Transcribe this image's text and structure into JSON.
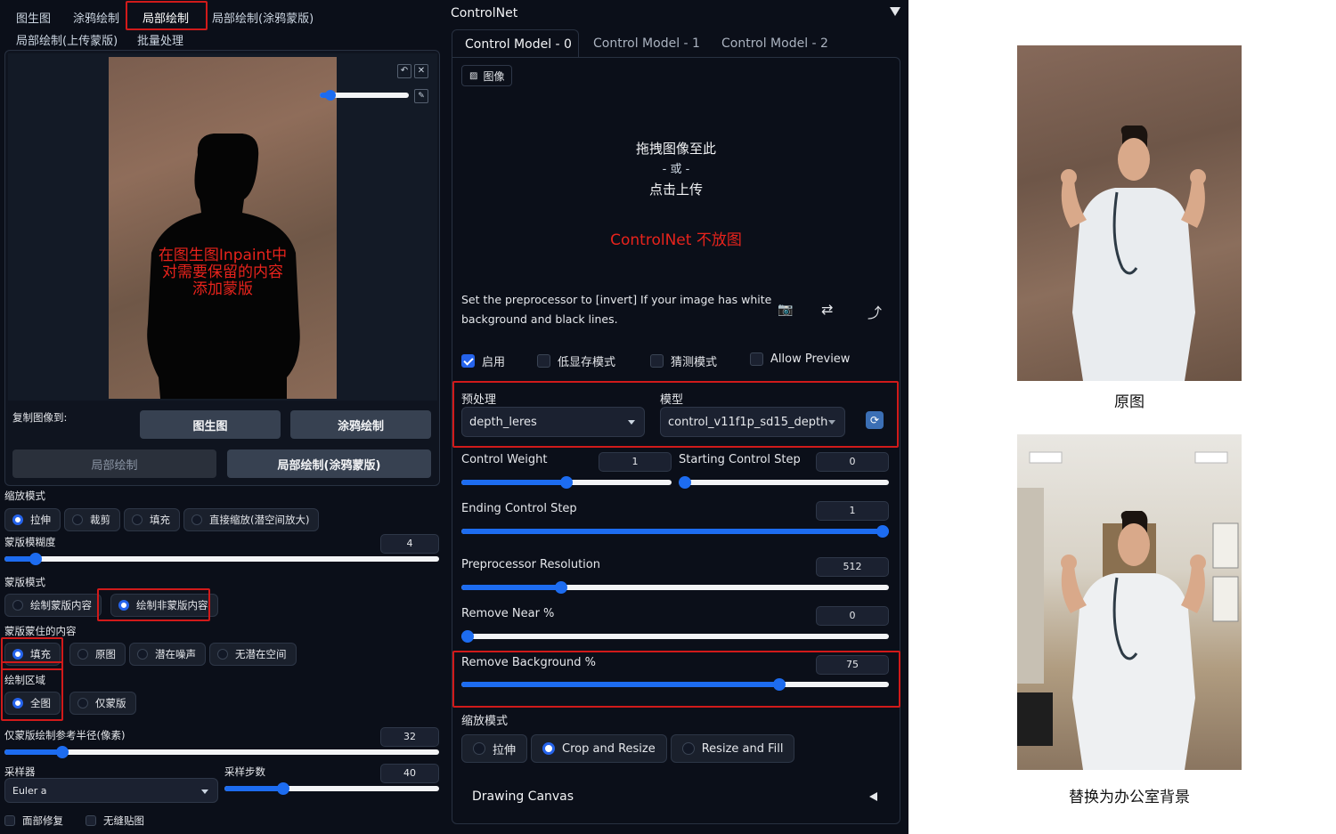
{
  "tabs": {
    "row1": [
      "图生图",
      "涂鸦绘制",
      "局部绘制",
      "局部绘制(涂鸦蒙版)"
    ],
    "row2": [
      "局部绘制(上传蒙版)",
      "批量处理"
    ]
  },
  "canvas": {
    "annotation_line1": "在图生图Inpaint中",
    "annotation_line2": "对需要保留的内容",
    "annotation_line3": "添加蒙版",
    "brush_value": 0.05
  },
  "copy_to": {
    "label": "复制图像到:",
    "btn_img2img": "图生图",
    "btn_sketch": "涂鸦绘制",
    "btn_inpaint": "局部绘制",
    "btn_inpaint_sketch": "局部绘制(涂鸦蒙版)"
  },
  "left": {
    "resize_mode_label": "缩放模式",
    "resize_modes": [
      "拉伸",
      "裁剪",
      "填充",
      "直接缩放(潜空间放大)"
    ],
    "resize_mode_selected": 0,
    "mask_blur_label": "蒙版模糊度",
    "mask_blur_value": "4",
    "mask_mode_label": "蒙版模式",
    "mask_modes": [
      "绘制蒙版内容",
      "绘制非蒙版内容"
    ],
    "mask_mode_selected": 1,
    "masked_content_label": "蒙版蒙住的内容",
    "masked_contents": [
      "填充",
      "原图",
      "潜在噪声",
      "无潜在空间"
    ],
    "masked_content_selected": 0,
    "inpaint_area_label": "绘制区域",
    "inpaint_areas": [
      "全图",
      "仅蒙版"
    ],
    "inpaint_area_selected": 0,
    "padding_label": "仅蒙版绘制参考半径(像素)",
    "padding_value": "32",
    "sampler_label": "采样器",
    "sampler_value": "Euler a",
    "steps_label": "采样步数",
    "steps_value": "40",
    "face_restore": "面部修复",
    "tiling": "无缝贴图"
  },
  "controlnet": {
    "title": "ControlNet",
    "tabs": [
      "Control Model - 0",
      "Control Model - 1",
      "Control Model - 2"
    ],
    "image_tab": "图像",
    "drop_line1": "拖拽图像至此",
    "drop_line2": "- 或 -",
    "drop_line3": "点击上传",
    "red_note": "ControlNet 不放图",
    "hint_line1": "Set the preprocessor to [invert] If your image has white",
    "hint_line2": "background and black lines.",
    "enable": "启用",
    "lowvram": "低显存模式",
    "guess": "猜测模式",
    "allow_preview": "Allow Preview",
    "preprocessor_label": "预处理",
    "preprocessor_value": "depth_leres",
    "model_label": "模型",
    "model_value": "control_v11f1p_sd15_depth",
    "control_weight_label": "Control Weight",
    "control_weight_value": "1",
    "start_step_label": "Starting Control Step",
    "start_step_value": "0",
    "end_step_label": "Ending Control Step",
    "end_step_value": "1",
    "pre_res_label": "Preprocessor Resolution",
    "pre_res_value": "512",
    "remove_near_label": "Remove Near %",
    "remove_near_value": "0",
    "remove_bg_label": "Remove Background %",
    "remove_bg_value": "75",
    "resize_mode_label": "缩放模式",
    "resize_modes": [
      "拉伸",
      "Crop and Resize",
      "Resize and Fill"
    ],
    "resize_mode_selected": 1,
    "drawing_canvas": "Drawing Canvas"
  },
  "results": {
    "original_caption": "原图",
    "result_caption": "替换为办公室背景"
  },
  "colors": {
    "accent": "#1d6cf0",
    "annotation_red": "#d11a1a",
    "background": "#0b0f19"
  }
}
